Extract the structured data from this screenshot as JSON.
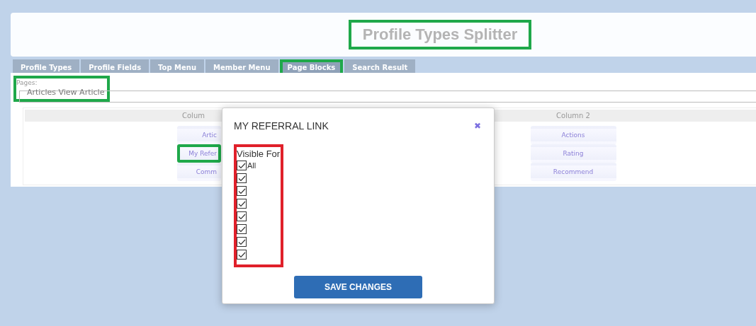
{
  "header": {
    "title": "Profile Types Splitter",
    "highlighted": true
  },
  "tabs": [
    {
      "label": "Profile Types",
      "selected": false,
      "highlighted": false
    },
    {
      "label": "Profile Fields",
      "selected": false,
      "highlighted": false
    },
    {
      "label": "Top Menu",
      "selected": false,
      "highlighted": false
    },
    {
      "label": "Member Menu",
      "selected": false,
      "highlighted": false
    },
    {
      "label": "Page Blocks",
      "selected": true,
      "highlighted": true
    },
    {
      "label": "Search Result",
      "selected": false,
      "highlighted": false
    }
  ],
  "pages": {
    "label": "Pages:",
    "value": "Articles View Article",
    "highlighted": true
  },
  "columns": [
    {
      "heading": "Colum",
      "blocks": [
        {
          "label": "Artic",
          "highlighted": false
        },
        {
          "label": "My Refer",
          "highlighted": true
        },
        {
          "label": "Comm",
          "highlighted": false
        }
      ]
    },
    {
      "heading": "Column 2",
      "blocks": [
        {
          "label": "Actions",
          "highlighted": false
        },
        {
          "label": "Rating",
          "highlighted": false
        },
        {
          "label": "Recommend",
          "highlighted": false
        }
      ]
    }
  ],
  "dialog": {
    "title": "MY REFERRAL LINK",
    "close": "✖",
    "group_label": "Visible For",
    "group_highlighted": true,
    "options": [
      {
        "label": "All",
        "checked": true
      },
      {
        "checked": true
      },
      {
        "checked": true
      },
      {
        "checked": true
      },
      {
        "checked": true
      },
      {
        "checked": true
      },
      {
        "checked": true
      },
      {
        "checked": true
      }
    ],
    "save": "SAVE CHANGES"
  }
}
